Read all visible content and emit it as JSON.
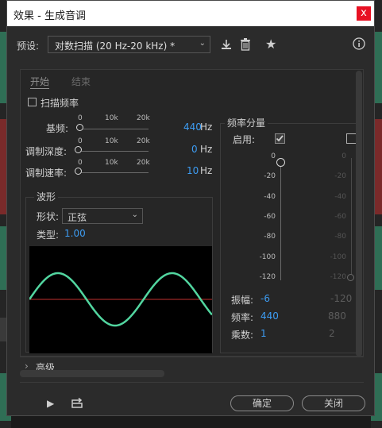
{
  "window": {
    "title": "效果 - 生成音调",
    "close_glyph": "x"
  },
  "preset": {
    "label": "预设:",
    "value": "对数扫描 (20 Hz-20 kHz) *"
  },
  "tabs": [
    {
      "label": "开始"
    },
    {
      "label": "结束"
    }
  ],
  "sweep": {
    "label": "扫描频率",
    "checked": false
  },
  "scale_labels": [
    "0",
    "10k",
    "20k"
  ],
  "params": [
    {
      "label": "基频:",
      "value": "440",
      "unit": "Hz"
    },
    {
      "label": "调制深度:",
      "value": "0",
      "unit": "Hz"
    },
    {
      "label": "调制速率:",
      "value": "10",
      "unit": "Hz"
    }
  ],
  "waveform": {
    "group_title": "波形",
    "shape_label": "形状:",
    "shape_value": "正弦",
    "type_label": "类型:",
    "type_value": "1.00"
  },
  "components": {
    "group_title": "频率分量",
    "enable_label": "启用:",
    "scale": [
      "0",
      "-20",
      "-40",
      "-60",
      "-80",
      "-100",
      "-120"
    ],
    "scale2": [
      "0",
      "-20",
      "-40",
      "-60",
      "-80",
      "-100",
      "-120"
    ],
    "amp_label": "振幅:",
    "amp1": "-6",
    "amp2": "-120",
    "freq_label": "频率:",
    "freq1": "440",
    "freq2": "880",
    "mult_label": "乘数:",
    "mult1": "1",
    "mult2": "2"
  },
  "advanced": {
    "label": "高级"
  },
  "buttons": {
    "ok": "确定",
    "close": "关闭"
  },
  "colors": {
    "accent": "#3d9cf2",
    "wave": "#52d6a0",
    "center_line": "#c0302e",
    "close": "#e81123"
  }
}
